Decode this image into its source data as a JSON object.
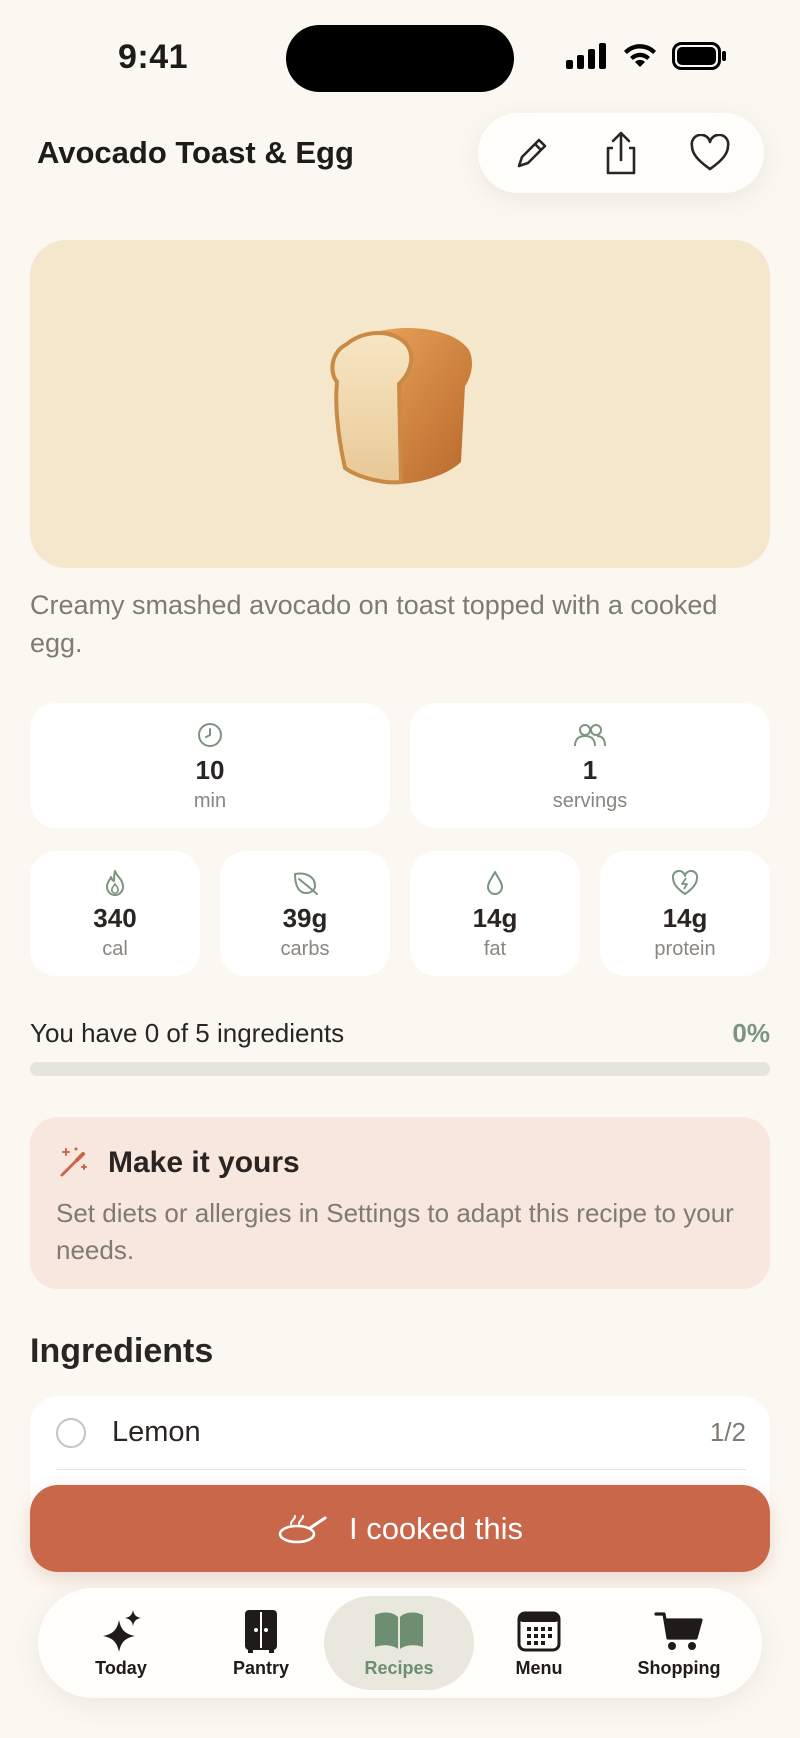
{
  "status_bar": {
    "time": "9:41"
  },
  "header": {
    "title": "Avocado Toast & Egg"
  },
  "hero": {
    "emoji": "🍞"
  },
  "description": "Creamy smashed avocado on toast topped with a cooked egg.",
  "stats_top": [
    {
      "icon": "clock-icon",
      "value": "10",
      "unit": "min"
    },
    {
      "icon": "people-icon",
      "value": "1",
      "unit": "servings"
    }
  ],
  "stats_nutrition": [
    {
      "icon": "flame-icon",
      "value": "340",
      "unit": "cal"
    },
    {
      "icon": "leaf-icon",
      "value": "39g",
      "unit": "carbs"
    },
    {
      "icon": "drop-icon",
      "value": "14g",
      "unit": "fat"
    },
    {
      "icon": "heart-bolt-icon",
      "value": "14g",
      "unit": "protein"
    }
  ],
  "progress": {
    "label": "You have 0 of 5 ingredients",
    "percent_label": "0%",
    "fraction": 0
  },
  "tip": {
    "title": "Make it yours",
    "text": "Set diets or allergies in Settings to adapt this recipe to your needs."
  },
  "ingredients": {
    "title": "Ingredients",
    "items": [
      {
        "name": "Lemon",
        "qty": "1/2"
      }
    ]
  },
  "cook_button": {
    "label": "I cooked this"
  },
  "tabs": [
    {
      "label": "Today",
      "icon": "sparkles-icon",
      "active": false
    },
    {
      "label": "Pantry",
      "icon": "cabinet-icon",
      "active": false
    },
    {
      "label": "Recipes",
      "icon": "book-icon",
      "active": true
    },
    {
      "label": "Menu",
      "icon": "calendar-icon",
      "active": false
    },
    {
      "label": "Shopping",
      "icon": "cart-icon",
      "active": false
    }
  ],
  "colors": {
    "background": "#FBF8F1",
    "accent": "#C9674A",
    "sage": "#7C9580",
    "hero_bg": "#F4E7CC",
    "tip_bg": "#F7E7DE"
  }
}
